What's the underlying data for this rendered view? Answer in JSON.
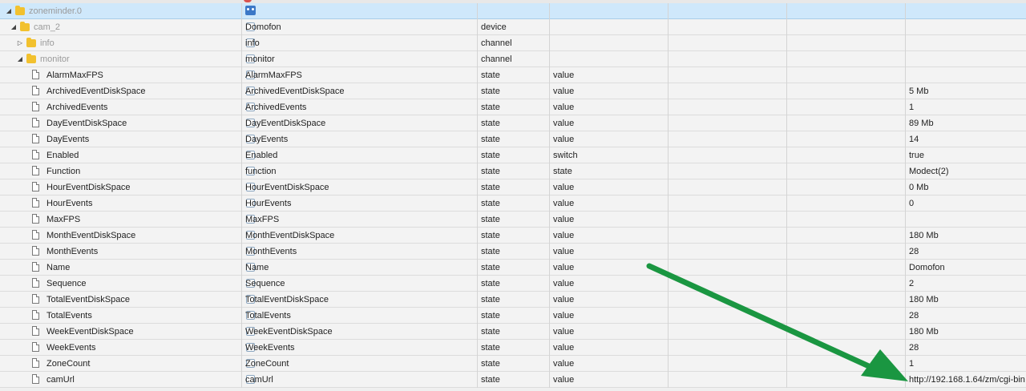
{
  "rows": [
    {
      "id": "zoneminder.0",
      "name": "",
      "type": "",
      "role": "",
      "value": "",
      "kind": "adapter",
      "indent": 0,
      "toggle": "◢",
      "muted": true,
      "selected": true
    },
    {
      "id": "cam_2",
      "name": "Domofon",
      "type": "device",
      "role": "",
      "value": "",
      "kind": "folder",
      "indent": 1,
      "toggle": "◢",
      "muted": true
    },
    {
      "id": "info",
      "name": "info",
      "type": "channel",
      "role": "",
      "value": "",
      "kind": "folder",
      "indent": 2,
      "toggle": "▷",
      "muted": true
    },
    {
      "id": "monitor",
      "name": "monitor",
      "type": "channel",
      "role": "",
      "value": "",
      "kind": "folder",
      "indent": 2,
      "toggle": "◢",
      "muted": true
    },
    {
      "id": "AlarmMaxFPS",
      "name": "AlarmMaxFPS",
      "type": "state",
      "role": "value",
      "value": "",
      "kind": "file",
      "indent": 3
    },
    {
      "id": "ArchivedEventDiskSpace",
      "name": "ArchivedEventDiskSpace",
      "type": "state",
      "role": "value",
      "value": "5 Mb",
      "kind": "file",
      "indent": 3
    },
    {
      "id": "ArchivedEvents",
      "name": "ArchivedEvents",
      "type": "state",
      "role": "value",
      "value": "1",
      "kind": "file",
      "indent": 3
    },
    {
      "id": "DayEventDiskSpace",
      "name": "DayEventDiskSpace",
      "type": "state",
      "role": "value",
      "value": "89 Mb",
      "kind": "file",
      "indent": 3
    },
    {
      "id": "DayEvents",
      "name": "DayEvents",
      "type": "state",
      "role": "value",
      "value": "14",
      "kind": "file",
      "indent": 3
    },
    {
      "id": "Enabled",
      "name": "Enabled",
      "type": "state",
      "role": "switch",
      "value": "true",
      "kind": "file",
      "indent": 3
    },
    {
      "id": "Function",
      "name": "function",
      "type": "state",
      "role": "state",
      "value": "Modect(2)",
      "kind": "file",
      "indent": 3
    },
    {
      "id": "HourEventDiskSpace",
      "name": "HourEventDiskSpace",
      "type": "state",
      "role": "value",
      "value": "0 Mb",
      "kind": "file",
      "indent": 3
    },
    {
      "id": "HourEvents",
      "name": "HourEvents",
      "type": "state",
      "role": "value",
      "value": "0",
      "kind": "file",
      "indent": 3
    },
    {
      "id": "MaxFPS",
      "name": "MaxFPS",
      "type": "state",
      "role": "value",
      "value": "",
      "kind": "file",
      "indent": 3
    },
    {
      "id": "MonthEventDiskSpace",
      "name": "MonthEventDiskSpace",
      "type": "state",
      "role": "value",
      "value": "180 Mb",
      "kind": "file",
      "indent": 3
    },
    {
      "id": "MonthEvents",
      "name": "MonthEvents",
      "type": "state",
      "role": "value",
      "value": "28",
      "kind": "file",
      "indent": 3
    },
    {
      "id": "Name",
      "name": "Name",
      "type": "state",
      "role": "value",
      "value": "Domofon",
      "kind": "file",
      "indent": 3
    },
    {
      "id": "Sequence",
      "name": "Sequence",
      "type": "state",
      "role": "value",
      "value": "2",
      "kind": "file",
      "indent": 3
    },
    {
      "id": "TotalEventDiskSpace",
      "name": "TotalEventDiskSpace",
      "type": "state",
      "role": "value",
      "value": "180 Mb",
      "kind": "file",
      "indent": 3
    },
    {
      "id": "TotalEvents",
      "name": "TotalEvents",
      "type": "state",
      "role": "value",
      "value": "28",
      "kind": "file",
      "indent": 3
    },
    {
      "id": "WeekEventDiskSpace",
      "name": "WeekEventDiskSpace",
      "type": "state",
      "role": "value",
      "value": "180 Mb",
      "kind": "file",
      "indent": 3
    },
    {
      "id": "WeekEvents",
      "name": "WeekEvents",
      "type": "state",
      "role": "value",
      "value": "28",
      "kind": "file",
      "indent": 3
    },
    {
      "id": "ZoneCount",
      "name": "ZoneCount",
      "type": "state",
      "role": "value",
      "value": "1",
      "kind": "file",
      "indent": 3
    },
    {
      "id": "camUrl",
      "name": "camUrl",
      "type": "state",
      "role": "value",
      "value": "http://192.168.1.64/zm/cgi-bin",
      "kind": "file",
      "indent": 3
    }
  ],
  "annotation": {
    "arrow_color": "#1a9641"
  },
  "icons": {
    "adapter": "robot-icon",
    "folder": "folder-icon",
    "file": "file-icon",
    "name": "object-icon"
  }
}
